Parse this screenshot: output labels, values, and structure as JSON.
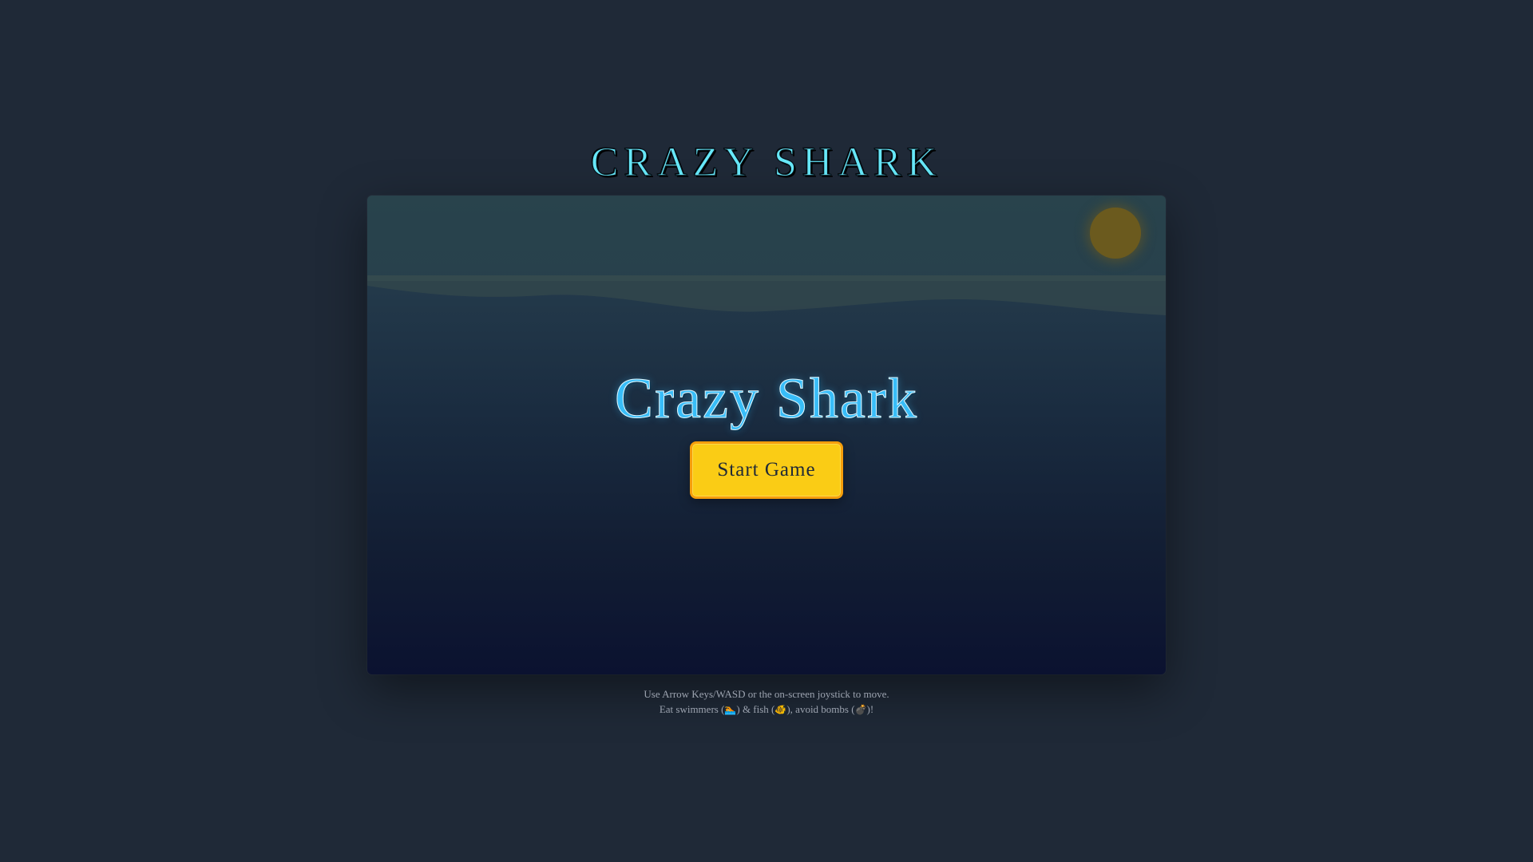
{
  "page": {
    "title": "CRAZY SHARK"
  },
  "game": {
    "heading": "Crazy Shark",
    "start_button_label": "Start Game",
    "colors": {
      "background": "#1f2937",
      "title": "#67e8f9",
      "heading": "#38bdf8",
      "button": "#facc15",
      "button_border": "#f59e0b",
      "sun": "#6b5a1e"
    }
  },
  "instructions": {
    "line1": "Use Arrow Keys/WASD or the on-screen joystick to move.",
    "line2_part1": "Eat swimmers (",
    "swimmer_icon": "🏊",
    "line2_part2": ") & fish (",
    "fish_icon": "🐠",
    "line2_part3": "), avoid bombs (",
    "bomb_icon": "💣",
    "line2_part4": ")!"
  }
}
